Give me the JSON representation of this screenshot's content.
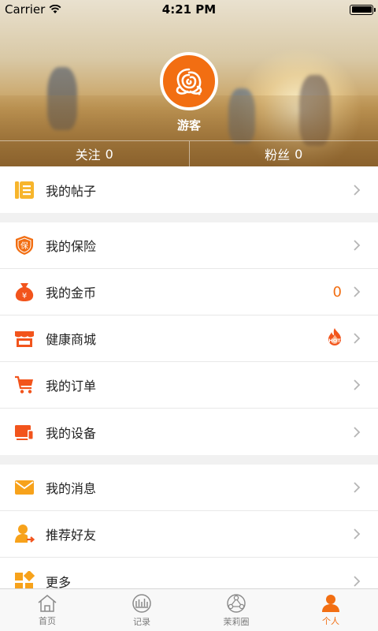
{
  "status_bar": {
    "carrier": "Carrier",
    "time": "4:21 PM"
  },
  "profile": {
    "nickname": "游客",
    "follow_label": "关注",
    "follow_count": "0",
    "fans_label": "粉丝",
    "fans_count": "0"
  },
  "groups": [
    {
      "rows": [
        {
          "label": "我的帖子",
          "icon": "posts-icon"
        }
      ]
    },
    {
      "rows": [
        {
          "label": "我的保险",
          "icon": "insurance-shield-icon",
          "icon_text": "保"
        },
        {
          "label": "我的金币",
          "icon": "coin-bag-icon",
          "icon_text": "¥",
          "value": "0"
        },
        {
          "label": "健康商城",
          "icon": "store-icon",
          "badge": "HOT"
        },
        {
          "label": "我的订单",
          "icon": "cart-icon"
        },
        {
          "label": "我的设备",
          "icon": "devices-icon"
        }
      ]
    },
    {
      "rows": [
        {
          "label": "我的消息",
          "icon": "mail-icon"
        },
        {
          "label": "推荐好友",
          "icon": "recommend-friend-icon"
        },
        {
          "label": "更多",
          "icon": "more-icon"
        }
      ]
    }
  ],
  "tabs": [
    {
      "label": "首页",
      "icon": "home-icon"
    },
    {
      "label": "记录",
      "icon": "record-icon"
    },
    {
      "label": "茉莉圈",
      "icon": "circle-network-icon"
    },
    {
      "label": "个人",
      "icon": "person-icon",
      "active": true
    }
  ],
  "colors": {
    "accent": "#f26e12",
    "yellow": "#f7b52c",
    "red": "#f2541c"
  }
}
